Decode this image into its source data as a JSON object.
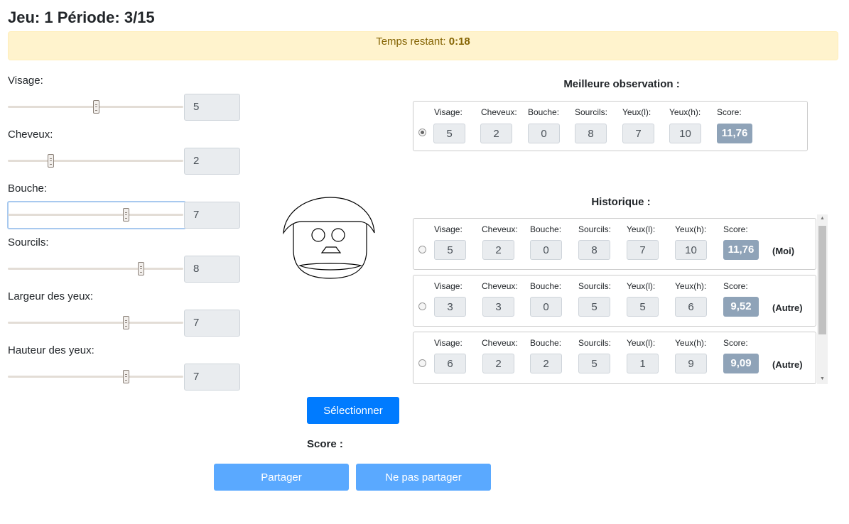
{
  "header": {
    "title": "Jeu: 1 Période: 3/15"
  },
  "timer": {
    "label": "Temps restant:",
    "value": "0:18"
  },
  "sliders": [
    {
      "label": "Visage:",
      "value": "5"
    },
    {
      "label": "Cheveux:",
      "value": "2"
    },
    {
      "label": "Bouche:",
      "value": "7"
    },
    {
      "label": "Sourcils:",
      "value": "8"
    },
    {
      "label": "Largeur des yeux:",
      "value": "7"
    },
    {
      "label": "Hauteur des yeux:",
      "value": "7"
    }
  ],
  "best": {
    "title": "Meilleure observation :",
    "headers": [
      "Visage:",
      "Cheveux:",
      "Bouche:",
      "Sourcils:",
      "Yeux(l):",
      "Yeux(h):",
      "Score:"
    ],
    "values": [
      "5",
      "2",
      "0",
      "8",
      "7",
      "10"
    ],
    "score": "11,76"
  },
  "history": {
    "title": "Historique :",
    "headers": [
      "Visage:",
      "Cheveux:",
      "Bouche:",
      "Sourcils:",
      "Yeux(l):",
      "Yeux(h):",
      "Score:"
    ],
    "rows": [
      {
        "values": [
          "5",
          "2",
          "0",
          "8",
          "7",
          "10"
        ],
        "score": "11,76",
        "who": "(Moi)"
      },
      {
        "values": [
          "3",
          "3",
          "0",
          "5",
          "5",
          "6"
        ],
        "score": "9,52",
        "who": "(Autre)"
      },
      {
        "values": [
          "6",
          "2",
          "2",
          "5",
          "1",
          "9"
        ],
        "score": "9,09",
        "who": "(Autre)"
      }
    ]
  },
  "actions": {
    "select_label": "Sélectionner",
    "score_label": "Score :",
    "share_label": "Partager",
    "noshare_label": "Ne pas partager"
  },
  "colors": {
    "primary": "#007bff",
    "primary_light": "#5aa9ff",
    "score_badge": "#8fa3b8",
    "timer_bg": "#fff3cd"
  }
}
